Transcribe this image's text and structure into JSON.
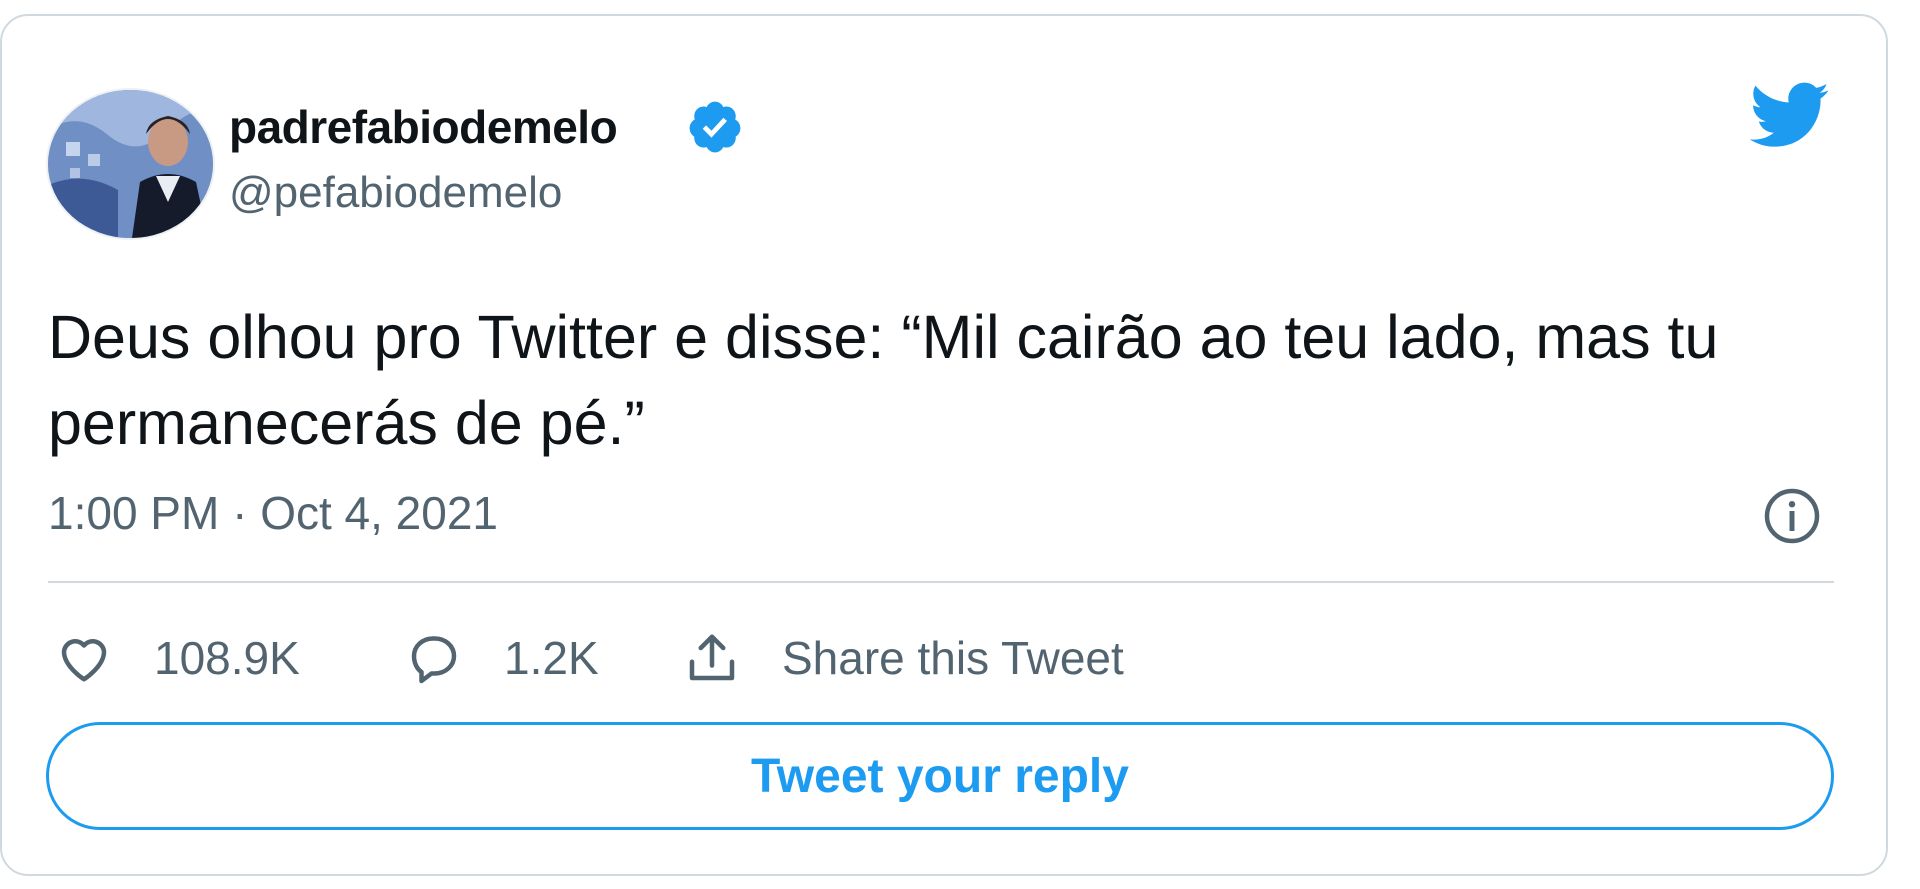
{
  "author": {
    "display_name": "padrefabiodemelo",
    "handle": "@pefabiodemelo",
    "verified": true
  },
  "tweet": {
    "text": "Deus olhou pro Twitter e disse: “Mil cairão ao teu lado, mas tu permanecerás de pé.”",
    "timestamp": "1:00 PM · Oct 4, 2021"
  },
  "actions": {
    "likes": "108.9K",
    "replies": "1.2K",
    "share_label": "Share this Tweet"
  },
  "reply_button": {
    "label": "Tweet your reply"
  },
  "icons": {
    "brand": "twitter-bird-icon",
    "verified": "verified-badge-icon",
    "info": "info-icon",
    "like": "heart-icon",
    "reply": "comment-icon",
    "share": "share-icon"
  },
  "colors": {
    "accent": "#1d9bf0",
    "text": "#0f1419",
    "secondary_text": "#536471",
    "border": "#cfd9de"
  }
}
